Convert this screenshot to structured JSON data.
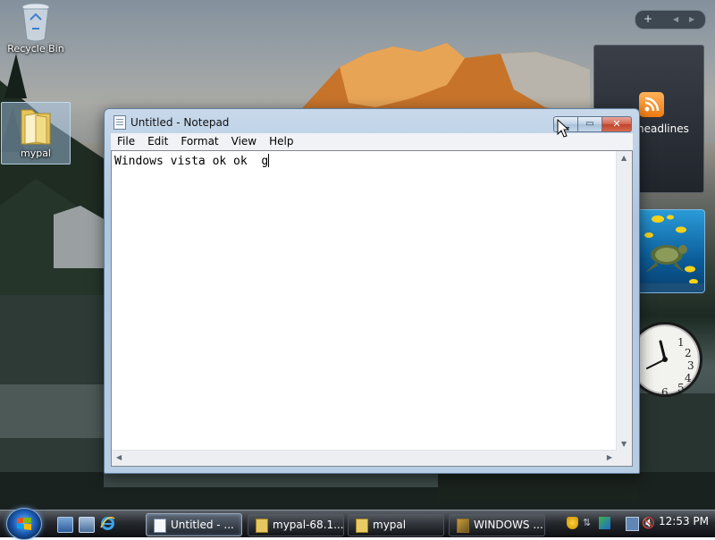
{
  "desktop": {
    "icons": [
      {
        "label": "Recycle Bin"
      },
      {
        "label": "mypal"
      }
    ]
  },
  "sidebar": {
    "controls": {
      "add": "+",
      "prev": "◀",
      "next": "▶"
    },
    "feed_gadget": {
      "title": "headlines"
    }
  },
  "notepad": {
    "title": "Untitled - Notepad",
    "menu": [
      "File",
      "Edit",
      "Format",
      "View",
      "Help"
    ],
    "content": "Windows vista ok ok  g"
  },
  "taskbar": {
    "buttons": [
      {
        "label": "Untitled - ...",
        "active": true
      },
      {
        "label": "mypal-68.1...",
        "active": false
      },
      {
        "label": "mypal",
        "active": false
      },
      {
        "label": "WINDOWS ...",
        "active": false
      }
    ],
    "clock": "12:53 PM"
  },
  "colors": {
    "taskbar": "#0d0f12",
    "window_frame": "#aec6e0",
    "close_button": "#c0432d"
  }
}
